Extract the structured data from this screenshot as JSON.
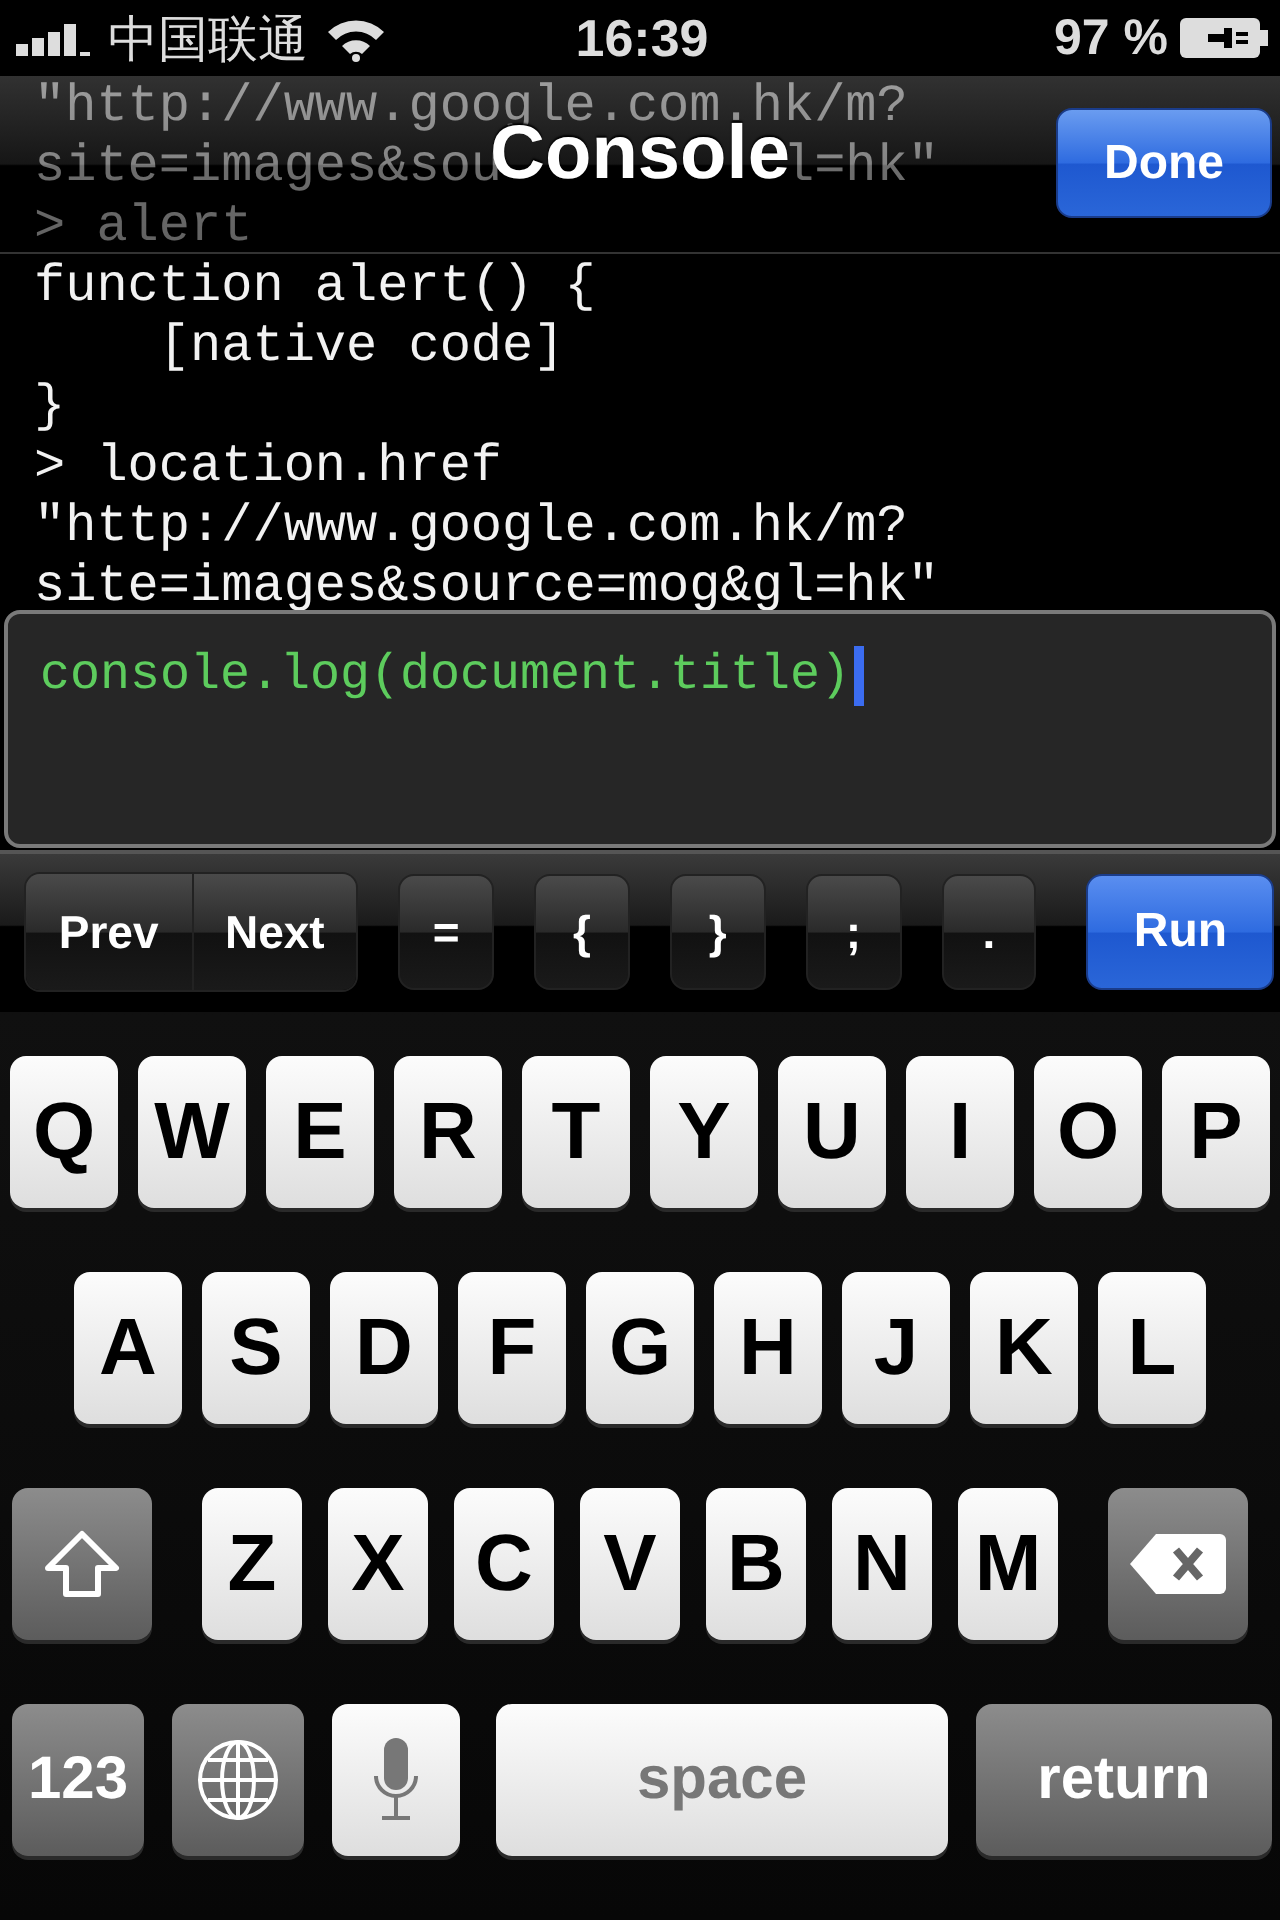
{
  "status_bar": {
    "carrier": "中国联通",
    "time": "16:39",
    "battery": "97 %"
  },
  "nav_bar": {
    "title": "Console",
    "done_button": "Done"
  },
  "log_lines": [
    {
      "segments": [
        "\"http://www.google.com.hk/m?"
      ]
    },
    {
      "segments": [
        "site=images&sou",
        "l=hk\""
      ]
    },
    {
      "segments": [
        "> alert"
      ]
    },
    {
      "segments": [
        "function alert() {"
      ]
    },
    {
      "segments": [
        "    [native code]"
      ]
    },
    {
      "segments": [
        "}"
      ]
    },
    {
      "segments": [
        "> location.href"
      ]
    },
    {
      "segments": [
        "\"http://www.google.com.hk/m?"
      ]
    },
    {
      "segments": [
        "site=images&source=mog&gl=hk\""
      ]
    }
  ],
  "input": {
    "value": "console.log(document.title)"
  },
  "toolbar": [
    {
      "kind": "segment",
      "labels": [
        "Prev",
        "Next"
      ]
    },
    {
      "kind": "key",
      "label": "="
    },
    {
      "kind": "key",
      "label": "{"
    },
    {
      "kind": "key",
      "label": "}"
    },
    {
      "kind": "key",
      "label": ";"
    },
    {
      "kind": "key",
      "label": "."
    },
    {
      "kind": "primary",
      "label": "Run"
    }
  ],
  "keyboard": [
    [
      {
        "kind": "letter",
        "label": "Q"
      },
      {
        "kind": "letter",
        "label": "W"
      },
      {
        "kind": "letter",
        "label": "E"
      },
      {
        "kind": "letter",
        "label": "R"
      },
      {
        "kind": "letter",
        "label": "T"
      },
      {
        "kind": "letter",
        "label": "Y"
      },
      {
        "kind": "letter",
        "label": "U"
      },
      {
        "kind": "letter",
        "label": "I"
      },
      {
        "kind": "letter",
        "label": "O"
      },
      {
        "kind": "letter",
        "label": "P"
      }
    ],
    [
      {
        "kind": "letter",
        "label": "A"
      },
      {
        "kind": "letter",
        "label": "S"
      },
      {
        "kind": "letter",
        "label": "D"
      },
      {
        "kind": "letter",
        "label": "F"
      },
      {
        "kind": "letter",
        "label": "G"
      },
      {
        "kind": "letter",
        "label": "H"
      },
      {
        "kind": "letter",
        "label": "J"
      },
      {
        "kind": "letter",
        "label": "K"
      },
      {
        "kind": "letter",
        "label": "L"
      }
    ],
    [
      {
        "kind": "shift"
      },
      {
        "kind": "letter",
        "label": "Z"
      },
      {
        "kind": "letter",
        "label": "X"
      },
      {
        "kind": "letter",
        "label": "C"
      },
      {
        "kind": "letter",
        "label": "V"
      },
      {
        "kind": "letter",
        "label": "B"
      },
      {
        "kind": "letter",
        "label": "N"
      },
      {
        "kind": "letter",
        "label": "M"
      },
      {
        "kind": "delete"
      }
    ],
    [
      {
        "kind": "numbers",
        "label": "123"
      },
      {
        "kind": "globe"
      },
      {
        "kind": "mic"
      },
      {
        "kind": "space",
        "label": "space"
      },
      {
        "kind": "return",
        "label": "return"
      }
    ]
  ]
}
